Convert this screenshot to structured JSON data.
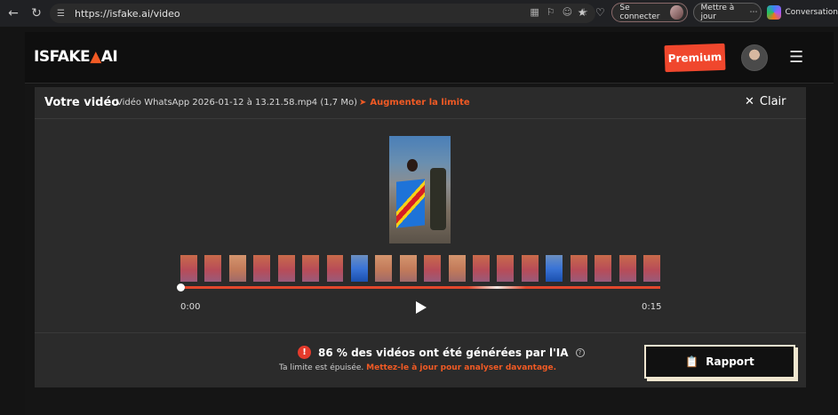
{
  "browser": {
    "url": "https://isfake.ai/video",
    "signin_label": "Se connecter",
    "update_label": "Mettre à jour",
    "copilot_label": "Conversation"
  },
  "site": {
    "brand_left": "ISFAKE",
    "brand_right": "AI",
    "premium_label": "Premium"
  },
  "panel": {
    "title": "Votre vidéo",
    "filename": "Vidéo WhatsApp 2026-01-12 à 13.21.58.mp4 (1,7 Mo)",
    "limit_label": "Augmenter la limite",
    "clear_label": "Clair",
    "time_start": "0:00",
    "time_end": "0:15",
    "progress": 0
  },
  "result": {
    "verdict": "86 % des vidéos ont été générées par l'IA",
    "limit_text": "Ta limite est épuisée.",
    "cta_text": "Mettez-le à jour pour analyser davantage.",
    "report_label": "Rapport"
  },
  "colors": {
    "accent": "#f15a24",
    "premium": "#f0472d",
    "report_border": "#f0e6cf"
  }
}
